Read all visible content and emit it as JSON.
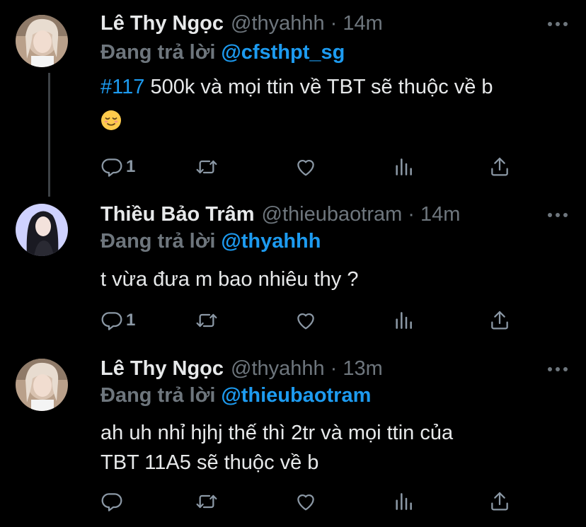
{
  "colors": {
    "background": "#000000",
    "link": "#1d9bf0",
    "muted": "#6e767d",
    "text": "#e7e9ea"
  },
  "tweets": [
    {
      "name": "Lê Thy Ngọc",
      "handle": "@thyahhh",
      "dot": "·",
      "time": "14m",
      "reply_prefix": "Đang trả lời",
      "reply_to": "@cfsthpt_sg",
      "hashtag": "#117",
      "text": "500k và mọi ttin về TBT sẽ thuộc về b",
      "emoji": "relieved-face-emoji",
      "reply_count": "1"
    },
    {
      "name": "Thiều Bảo Trâm",
      "handle": "@thieubaotram",
      "dot": "·",
      "time": "14m",
      "reply_prefix": "Đang trả lời",
      "reply_to": "@thyahhh",
      "text": "t vừa đưa m bao nhiêu thy ?",
      "reply_count": "1"
    },
    {
      "name": "Lê Thy Ngọc",
      "handle": "@thyahhh",
      "dot": "·",
      "time": "13m",
      "reply_prefix": "Đang trả lời",
      "reply_to": "@thieubaotram",
      "text_line1": "ah uh nhỉ hjhj thế thì 2tr và mọi ttin của",
      "text_line2": "TBT 11A5 sẽ thuộc về b",
      "reply_count": ""
    }
  ],
  "icons": [
    "reply-icon",
    "retweet-icon",
    "like-icon",
    "analytics-icon",
    "share-icon",
    "more-icon"
  ]
}
